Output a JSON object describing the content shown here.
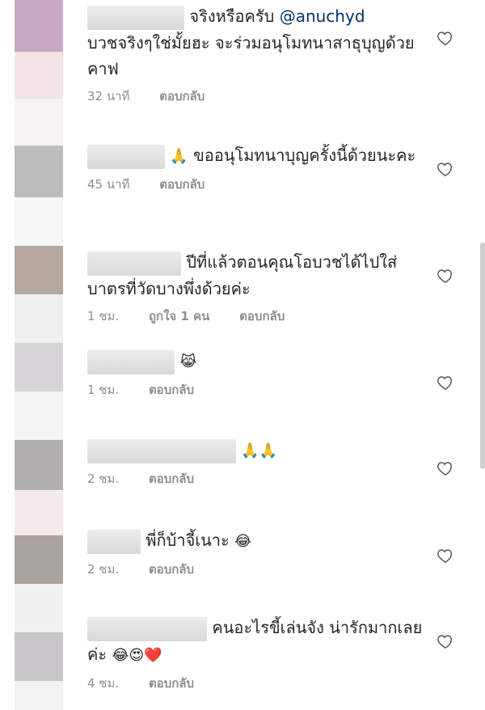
{
  "comments": [
    {
      "text_before": "จริงหรือครับ ",
      "mention": "@anuchyd",
      "text_after": "บวชจริงๆใช่มั้ยฮะ จะร่วมอนุโมทนาสาธุบุญด้วยคาฟ",
      "time": "32 นาที",
      "likes": "",
      "reply": "ตอบกลับ"
    },
    {
      "text_before": "",
      "emoji": "🙏",
      "text_after": " ขออนุโมทนาบุญครั้งนี้ด้วยนะคะ",
      "time": "45 นาที",
      "likes": "",
      "reply": "ตอบกลับ"
    },
    {
      "text_before": "ปีที่แล้วตอนคุณโอบวชได้ไปใส่บาตรที่วัดบางพึ่งด้วยค่ะ",
      "time": "1 ชม.",
      "likes": "ถูกใจ 1 คน",
      "reply": "ตอบกลับ"
    },
    {
      "text_before": "",
      "emoji": "😹",
      "time": "1 ชม.",
      "likes": "",
      "reply": "ตอบกลับ"
    },
    {
      "text_before": "",
      "emoji": "🙏🙏",
      "time": "2 ชม.",
      "likes": "",
      "reply": "ตอบกลับ"
    },
    {
      "text_before": "พี่ก็บ้าจี้เนาะ ",
      "emoji": "😂",
      "time": "2 ชม.",
      "likes": "",
      "reply": "ตอบกลับ"
    },
    {
      "text_before": "คนอะไรขี้เล่นจัง น่ารักมากเลยค่ะ ",
      "emoji": "😂😍❤️",
      "time": "4 ชม.",
      "likes": "",
      "reply": "ตอบกลับ"
    }
  ],
  "icons": {
    "like": "heart-outline-icon"
  },
  "colors": {
    "mention": "#003569",
    "meta": "#8e8e8e"
  }
}
